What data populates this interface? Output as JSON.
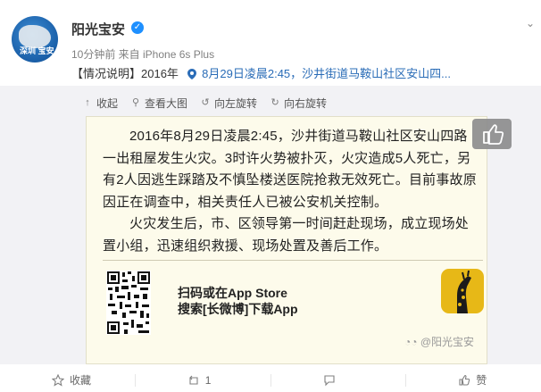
{
  "post": {
    "author": "阳光宝安",
    "meta": "10分钟前 来自 iPhone 6s Plus",
    "summary_prefix": "【情况说明】2016年",
    "summary_link": "8月29日凌晨2:45，沙井街道马鞍山社区安山四...",
    "avatar_mark": "深圳 宝安"
  },
  "toolbar": {
    "collapse": "收起",
    "view_large": "查看大图",
    "rotate_left": "向左旋转",
    "rotate_right": "向右旋转"
  },
  "image": {
    "paragraph1": "2016年8月29日凌晨2:45，沙井街道马鞍山社区安山四路一出租屋发生火灾。3时许火势被扑灭，火灾造成5人死亡，另有2人因逃生踩踏及不慎坠楼送医院抢救无效死亡。目前事故原因正在调查中，相关责任人已被公安机关控制。",
    "paragraph2": "火灾发生后，市、区领导第一时间赶赴现场，成立现场处置小组，迅速组织救援、现场处置及善后工作。",
    "cta_line1": "扫码或在App Store",
    "cta_line2": "搜索[长微博]下载App",
    "watermark": "@阳光宝安"
  },
  "actions": {
    "favorite": "收藏",
    "repost": "1",
    "comment": "",
    "like": "赞"
  },
  "colors": {
    "link": "#2a6cb7",
    "verified": "#1e90ff",
    "app_icon": "#e7b817"
  }
}
